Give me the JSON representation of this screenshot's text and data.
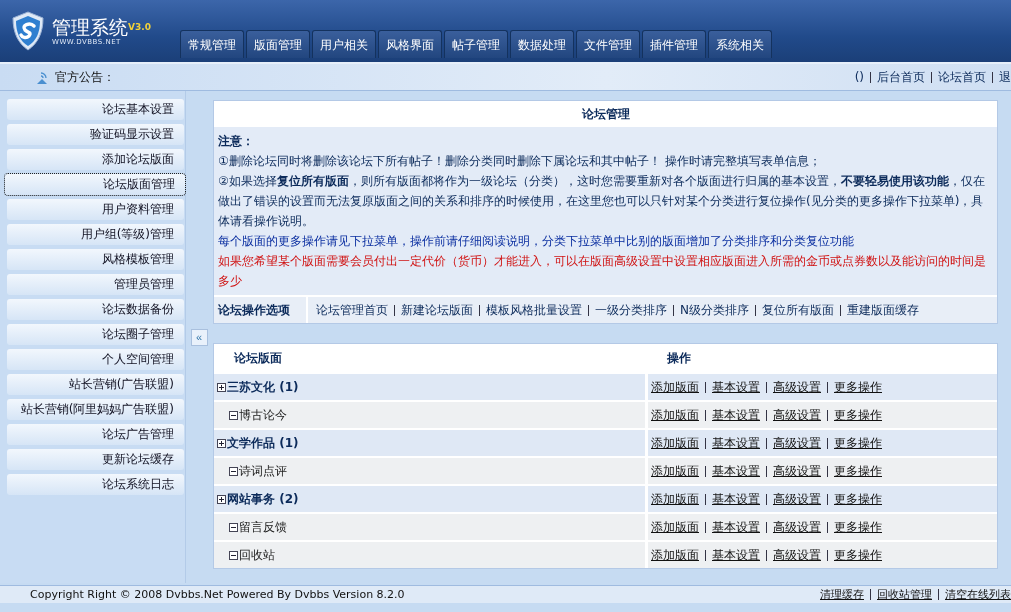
{
  "header": {
    "logo_title": "管理系统",
    "version": "V3.0",
    "logo_subtitle": "WWW.DVBBS.NET",
    "tabs": [
      {
        "label": "常规管理"
      },
      {
        "label": "版面管理"
      },
      {
        "label": "用户相关"
      },
      {
        "label": "风格界面"
      },
      {
        "label": "帖子管理"
      },
      {
        "label": "数据处理"
      },
      {
        "label": "文件管理"
      },
      {
        "label": "插件管理"
      },
      {
        "label": "系统相关"
      }
    ]
  },
  "announcement": {
    "label": "官方公告：",
    "links": [
      "()",
      "后台首页",
      "论坛首页",
      "退"
    ]
  },
  "sidebar": {
    "items": [
      {
        "label": "论坛基本设置",
        "selected": false
      },
      {
        "label": "验证码显示设置",
        "selected": false
      },
      {
        "label": "添加论坛版面",
        "selected": false
      },
      {
        "label": "论坛版面管理",
        "selected": true
      },
      {
        "label": "用户资料管理",
        "selected": false
      },
      {
        "label": "用户组(等级)管理",
        "selected": false
      },
      {
        "label": "风格模板管理",
        "selected": false
      },
      {
        "label": "管理员管理",
        "selected": false
      },
      {
        "label": "论坛数据备份",
        "selected": false
      },
      {
        "label": "论坛圈子管理",
        "selected": false
      },
      {
        "label": "个人空间管理",
        "selected": false
      },
      {
        "label": "站长营销(广告联盟)",
        "selected": false
      },
      {
        "label": "站长营销(阿里妈妈广告联盟)",
        "selected": false
      },
      {
        "label": "论坛广告管理",
        "selected": false
      },
      {
        "label": "更新论坛缓存",
        "selected": false
      },
      {
        "label": "论坛系统日志",
        "selected": false
      }
    ],
    "collapse": "«"
  },
  "notice": {
    "title": "论坛管理",
    "heading": "注意：",
    "lines": [
      {
        "kind": "note",
        "text": "①删除论坛同时将删除该论坛下所有帖子！删除分类同时删除下属论坛和其中帖子！  操作时请完整填写表单信息；"
      },
      {
        "kind": "note",
        "text": "②如果选择**复位所有版面**，则所有版面都将作为一级论坛（分类），这时您需要重新对各个版面进行归属的基本设置，**不要轻易使用该功能**，仅在做出了错误的设置而无法复原版面之间的关系和排序的时候使用，在这里您也可以只针对某个分类进行复位操作(见分类的更多操作下拉菜单)，具体请看操作说明。"
      },
      {
        "kind": "info",
        "text": "每个版面的更多操作请见下拉菜单，操作前请仔细阅读说明，分类下拉菜单中比别的版面增加了分类排序和分类复位功能"
      },
      {
        "kind": "warning",
        "text": "如果您希望某个版面需要会员付出一定代价（货币）才能进入，可以在版面高级设置中设置相应版面进入所需的金币或点券数以及能访问的时间是多少"
      }
    ],
    "options_label": "论坛操作选项",
    "options": [
      "论坛管理首页",
      "新建论坛版面",
      "模板风格批量设置",
      "一级分类排序",
      "N级分类排序",
      "复位所有版面",
      "重建版面缓存"
    ]
  },
  "table": {
    "columns": [
      "论坛版面",
      "操作"
    ],
    "rows": [
      {
        "kind": "category",
        "name": "三苏文化 (1)",
        "actions": [
          "添加版面",
          "基本设置",
          "高级设置",
          "更多操作"
        ]
      },
      {
        "kind": "board",
        "name": "博古论今",
        "actions": [
          "添加版面",
          "基本设置",
          "高级设置",
          "更多操作"
        ]
      },
      {
        "kind": "category",
        "name": "文学作品 (1)",
        "actions": [
          "添加版面",
          "基本设置",
          "高级设置",
          "更多操作"
        ]
      },
      {
        "kind": "board",
        "name": "诗词点评",
        "actions": [
          "添加版面",
          "基本设置",
          "高级设置",
          "更多操作"
        ]
      },
      {
        "kind": "category",
        "name": "网站事务 (2)",
        "actions": [
          "添加版面",
          "基本设置",
          "高级设置",
          "更多操作"
        ]
      },
      {
        "kind": "board",
        "name": "留言反馈",
        "actions": [
          "添加版面",
          "基本设置",
          "高级设置",
          "更多操作"
        ]
      },
      {
        "kind": "board",
        "name": "回收站",
        "actions": [
          "添加版面",
          "基本设置",
          "高级设置",
          "更多操作"
        ]
      }
    ]
  },
  "footer": {
    "copyright": "Copyright Right © 2008 Dvbbs.Net Powered By Dvbbs Version 8.2.0",
    "links": [
      "清理缓存",
      "回收站管理",
      "清空在线列表"
    ]
  }
}
